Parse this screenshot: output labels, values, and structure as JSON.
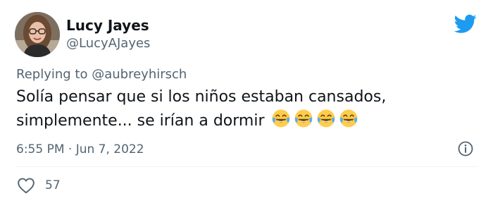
{
  "author": {
    "display_name": "Lucy Jayes",
    "handle": "@LucyAJayes"
  },
  "reply": {
    "prefix": "Replying to",
    "mention": "@aubreyhirsch"
  },
  "tweet": {
    "line1": "Solía pensar que si los niños estaban cansados,",
    "line2": "simplemente... se irían a dormir",
    "emoji": "face-with-tears-of-joy",
    "emoji_count": 4,
    "timestamp": "6:55 PM · Jun 7, 2022"
  },
  "actions": {
    "like_count": "57"
  },
  "icons": {
    "platform": "twitter-bird-icon",
    "info": "info-icon",
    "like": "heart-icon"
  },
  "colors": {
    "brand": "#1d9bf0",
    "text": "#0f1419",
    "secondary": "#536471",
    "emoji_face": "#ffcc4d"
  }
}
